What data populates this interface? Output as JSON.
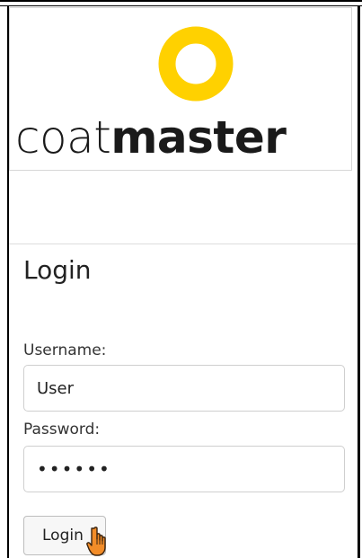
{
  "logo": {
    "text_light": "coat",
    "text_bold": "master",
    "ring_color": "#FFD100",
    "icon": "coatmaster-ring-logo"
  },
  "login": {
    "heading": "Login",
    "username_label": "Username:",
    "username_value": "User",
    "password_label": "Password:",
    "password_value": "••••••",
    "button_label": "Login"
  },
  "cursor": {
    "icon": "hand-pointer-icon",
    "color": "#F28C28"
  }
}
